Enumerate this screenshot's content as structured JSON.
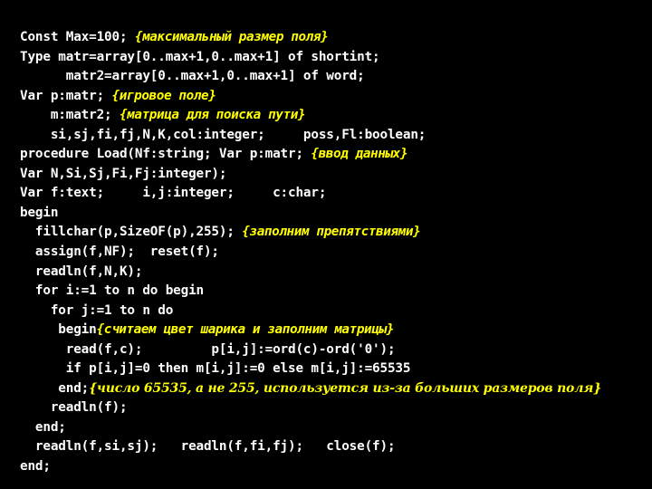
{
  "slide": {
    "background_color": "#000000",
    "code_color": "#ffffff",
    "comment_color": "#ffff00",
    "language": "Pascal"
  },
  "code": {
    "lines": [
      {
        "id": "line-1",
        "tokens": [
          {
            "kind": "code",
            "text": "Const Max=100; "
          },
          {
            "kind": "comment",
            "text": "{максимальный размер поля}"
          }
        ]
      },
      {
        "id": "line-2",
        "tokens": [
          {
            "kind": "code",
            "text": "Type matr=array[0..max+1,0..max+1] of shortint;"
          }
        ]
      },
      {
        "id": "line-3",
        "tokens": [
          {
            "kind": "code",
            "text": "      matr2=array[0..max+1,0..max+1] of word;"
          }
        ]
      },
      {
        "id": "line-4",
        "tokens": [
          {
            "kind": "code",
            "text": "Var p:matr; "
          },
          {
            "kind": "comment",
            "text": "{игровое поле}"
          }
        ]
      },
      {
        "id": "line-5",
        "tokens": [
          {
            "kind": "code",
            "text": "    m:matr2; "
          },
          {
            "kind": "comment",
            "text": "{матрица для поиска пути}"
          }
        ]
      },
      {
        "id": "line-6",
        "tokens": [
          {
            "kind": "code",
            "text": "    si,sj,fi,fj,N,K,col:integer;     poss,Fl:boolean;"
          }
        ]
      },
      {
        "id": "line-7",
        "tokens": [
          {
            "kind": "code",
            "text": "procedure Load(Nf:string; Var p:matr; "
          },
          {
            "kind": "comment",
            "text": "{ввод данных}"
          }
        ]
      },
      {
        "id": "line-8",
        "tokens": [
          {
            "kind": "code",
            "text": "Var N,Si,Sj,Fi,Fj:integer);"
          }
        ]
      },
      {
        "id": "line-9",
        "tokens": [
          {
            "kind": "code",
            "text": "Var f:text;     i,j:integer;     c:char;"
          }
        ]
      },
      {
        "id": "line-10",
        "tokens": [
          {
            "kind": "code",
            "text": "begin"
          }
        ]
      },
      {
        "id": "line-11",
        "tokens": [
          {
            "kind": "code",
            "text": "  fillchar(p,SizeOF(p),255); "
          },
          {
            "kind": "comment",
            "text": "{заполним препятствиями}"
          }
        ]
      },
      {
        "id": "line-12",
        "tokens": [
          {
            "kind": "code",
            "text": "  assign(f,NF);  reset(f);"
          }
        ]
      },
      {
        "id": "line-13",
        "tokens": [
          {
            "kind": "code",
            "text": "  readln(f,N,K);"
          }
        ]
      },
      {
        "id": "line-14",
        "tokens": [
          {
            "kind": "code",
            "text": "  for i:=1 to n do begin"
          }
        ]
      },
      {
        "id": "line-15",
        "tokens": [
          {
            "kind": "code",
            "text": "    for j:=1 to n do"
          }
        ]
      },
      {
        "id": "line-16",
        "tokens": [
          {
            "kind": "code",
            "text": "     begin"
          },
          {
            "kind": "comment",
            "text": "{считаем цвет шарика и заполним матрицы}"
          }
        ]
      },
      {
        "id": "line-17",
        "tokens": [
          {
            "kind": "code",
            "text": "      read(f,c);         p[i,j]:=ord(c)-ord('0');"
          }
        ]
      },
      {
        "id": "line-18",
        "tokens": [
          {
            "kind": "code",
            "text": "      if p[i,j]=0 then m[i,j]:=0 else m[i,j]:=65535"
          }
        ]
      },
      {
        "id": "line-19",
        "tokens": [
          {
            "kind": "code",
            "text": "     end;"
          },
          {
            "kind": "comment-serif",
            "text": "{число 65535, а не 255, используется из-за больших размеров поля}"
          }
        ]
      },
      {
        "id": "line-20",
        "tokens": [
          {
            "kind": "code",
            "text": "    readln(f);"
          }
        ]
      },
      {
        "id": "line-21",
        "tokens": [
          {
            "kind": "code",
            "text": "  end;"
          }
        ]
      },
      {
        "id": "line-22",
        "tokens": [
          {
            "kind": "code",
            "text": "  readln(f,si,sj);   readln(f,fi,fj);   close(f);"
          }
        ]
      },
      {
        "id": "line-23",
        "tokens": [
          {
            "kind": "code",
            "text": "end;"
          }
        ]
      }
    ]
  }
}
